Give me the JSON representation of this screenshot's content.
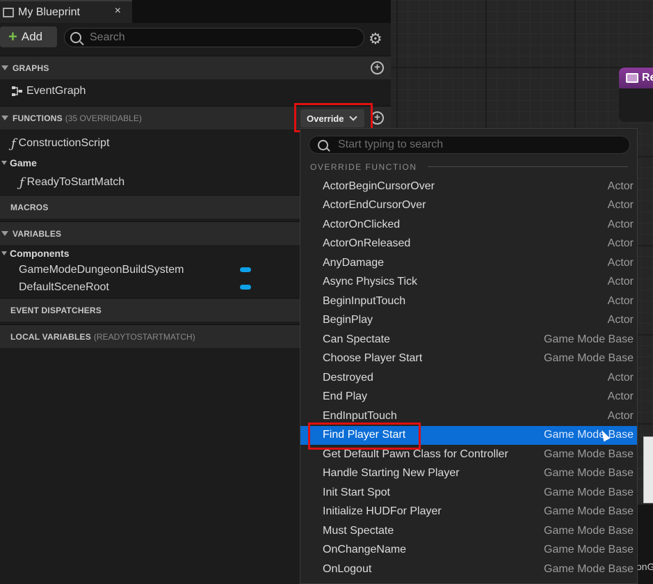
{
  "tab": {
    "title": "My Blueprint",
    "close": "×"
  },
  "toolbar": {
    "add_label": "Add",
    "search_placeholder": "Search"
  },
  "sections": {
    "graphs": "GRAPHS",
    "functions": "FUNCTIONS",
    "functions_sub": "(35 OVERRIDABLE)",
    "macros": "MACROS",
    "variables": "VARIABLES",
    "event_dispatchers": "EVENT DISPATCHERS",
    "local_variables": "LOCAL VARIABLES",
    "local_variables_sub": "(READYTOSTARTMATCH)"
  },
  "graphs": {
    "event_graph": "EventGraph"
  },
  "functions": {
    "construction_script": "ConstructionScript",
    "category_game": "Game",
    "ready_to_start_match": "ReadyToStartMatch"
  },
  "variables": {
    "category_components": "Components",
    "items": [
      "GameModeDungeonBuildSystem",
      "DefaultSceneRoot"
    ]
  },
  "override_button": {
    "label": "Override"
  },
  "dropdown": {
    "search_placeholder": "Start typing to search",
    "category": "OVERRIDE FUNCTION",
    "rows": [
      {
        "name": "ActorBeginCursorOver",
        "owner": "Actor"
      },
      {
        "name": "ActorEndCursorOver",
        "owner": "Actor"
      },
      {
        "name": "ActorOnClicked",
        "owner": "Actor"
      },
      {
        "name": "ActorOnReleased",
        "owner": "Actor"
      },
      {
        "name": "AnyDamage",
        "owner": "Actor"
      },
      {
        "name": "Async Physics Tick",
        "owner": "Actor"
      },
      {
        "name": "BeginInputTouch",
        "owner": "Actor"
      },
      {
        "name": "BeginPlay",
        "owner": "Actor"
      },
      {
        "name": "Can Spectate",
        "owner": "Game Mode Base"
      },
      {
        "name": "Choose Player Start",
        "owner": "Game Mode Base"
      },
      {
        "name": "Destroyed",
        "owner": "Actor"
      },
      {
        "name": "End Play",
        "owner": "Actor"
      },
      {
        "name": "EndInputTouch",
        "owner": "Actor"
      },
      {
        "name": "Find Player Start",
        "owner": "Game Mode Base",
        "selected": true
      },
      {
        "name": "Get Default Pawn Class for Controller",
        "owner": "Game Mode Base"
      },
      {
        "name": "Handle Starting New Player",
        "owner": "Game Mode Base"
      },
      {
        "name": "Init Start Spot",
        "owner": "Game Mode Base"
      },
      {
        "name": "Initialize HUDFor Player",
        "owner": "Game Mode Base"
      },
      {
        "name": "Must Spectate",
        "owner": "Game Mode Base"
      },
      {
        "name": "OnChangeName",
        "owner": "Game Mode Base"
      },
      {
        "name": "OnLogout",
        "owner": "Game Mode Base"
      }
    ]
  },
  "graph_node": {
    "title": "Re"
  },
  "graph_bottom_text": "onG",
  "colors": {
    "selection": "#0b6dd6",
    "highlight_box": "#e01010",
    "variable_pill": "#0ea0e8",
    "node_header": "#8a3b9a"
  }
}
